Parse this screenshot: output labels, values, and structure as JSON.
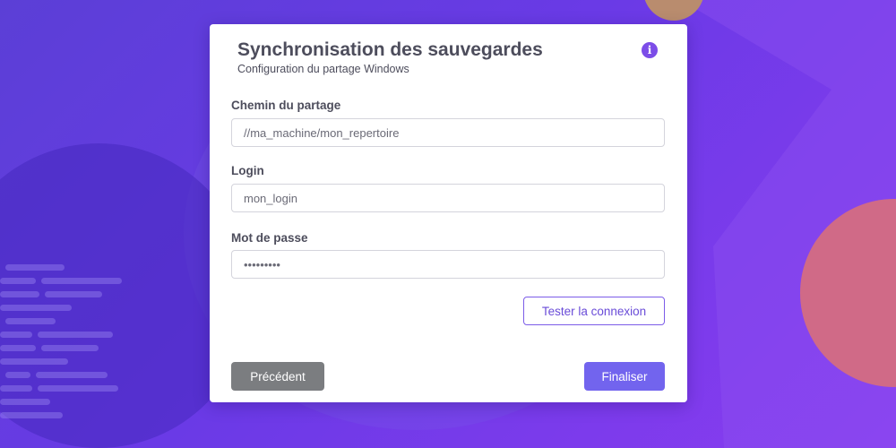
{
  "dialog": {
    "title": "Synchronisation des sauvegardes",
    "subtitle": "Configuration du partage Windows",
    "info_icon": "info-icon"
  },
  "form": {
    "share_path": {
      "label": "Chemin du partage",
      "placeholder": "//ma_machine/mon_repertoire"
    },
    "login": {
      "label": "Login",
      "placeholder": "mon_login"
    },
    "password": {
      "label": "Mot de passe",
      "placeholder": "•••••••••"
    }
  },
  "buttons": {
    "test_connection": "Tester la connexion",
    "previous": "Précédent",
    "finish": "Finaliser"
  },
  "colors": {
    "accent": "#7264ee",
    "secondary_button": "#7b7d80",
    "background_gradient": [
      "#5b3fd6",
      "#8a3cf0"
    ]
  }
}
